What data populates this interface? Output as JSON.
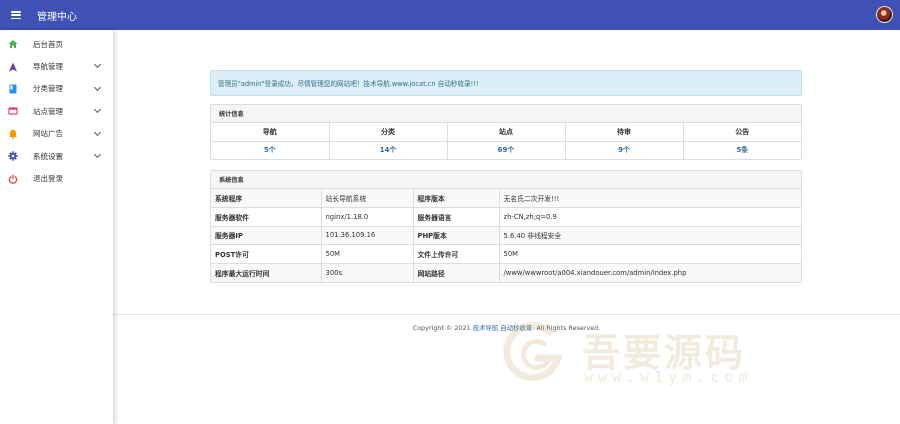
{
  "header": {
    "title": "管理中心",
    "menu_icon": "hamburger-icon",
    "bg": "#3f51b5"
  },
  "sidebar": {
    "items": [
      {
        "label": "后台首页",
        "icon": "home-icon",
        "color": "#4caf50",
        "expandable": false
      },
      {
        "label": "导航管理",
        "icon": "navigation-icon",
        "color": "#673ab7",
        "expandable": true
      },
      {
        "label": "分类管理",
        "icon": "book-icon",
        "color": "#2196f3",
        "expandable": true
      },
      {
        "label": "站点管理",
        "icon": "site-icon",
        "color": "#e91e63",
        "expandable": true
      },
      {
        "label": "网站广告",
        "icon": "bell-icon",
        "color": "#ff9800",
        "expandable": true
      },
      {
        "label": "系统设置",
        "icon": "gear-icon",
        "color": "#3f51b5",
        "expandable": true
      },
      {
        "label": "退出登录",
        "icon": "power-icon",
        "color": "#f44336",
        "expandable": false
      }
    ]
  },
  "alert": {
    "text": "管理员\"admin\"登录成功，尽情管理您的网站吧！技术导航.www.jocat.cn 自动秒收录!!!"
  },
  "stats": {
    "title": "统计信息",
    "headers": [
      "导航",
      "分类",
      "站点",
      "待审",
      "公告"
    ],
    "values": [
      "5个",
      "14个",
      "69个",
      "9个",
      "5条"
    ]
  },
  "system": {
    "title": "系统信息",
    "rows": [
      [
        "系统程序",
        "站长导航系统",
        "程序版本",
        "无名氏二次开发!!!"
      ],
      [
        "服务器软件",
        "nginx/1.18.0",
        "服务器语言",
        "zh-CN,zh;q=0.9"
      ],
      [
        "服务器IP",
        "101.36.109.16",
        "PHP版本",
        "5.6.40 非线程安全"
      ],
      [
        "POST许可",
        "50M",
        "文件上传许可",
        "50M"
      ],
      [
        "程序最大运行时间",
        "300s",
        "网站路径",
        "/www/wwwroot/a004.xiandouer.com/admin/index.php"
      ]
    ]
  },
  "footer": {
    "prefix": "Copyright © 2021 ",
    "link": "技术导航 自动秒收录",
    "suffix": ". All Rights Reserved."
  },
  "watermark": {
    "text": "吾要源码",
    "url": "www.w1ym.com"
  }
}
